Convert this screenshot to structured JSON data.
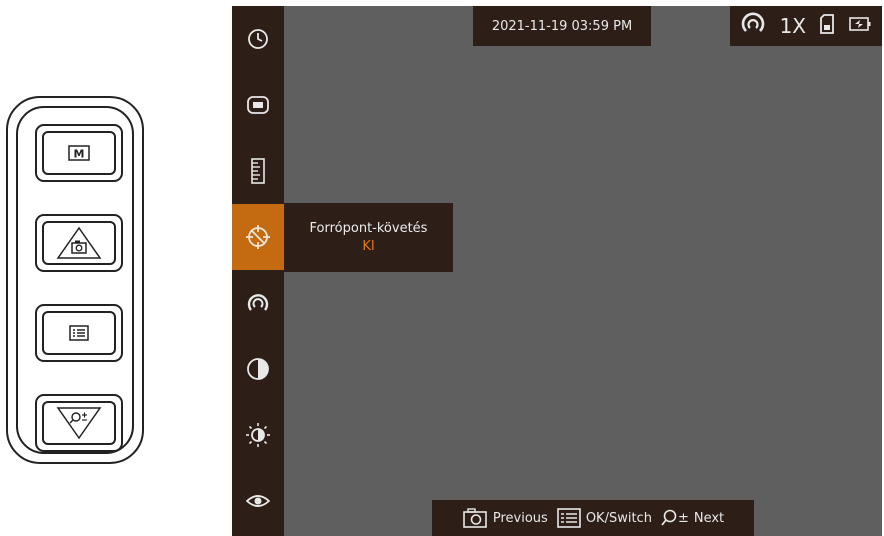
{
  "remote": {
    "buttons": [
      {
        "name": "m-button",
        "icon": "m-key-icon",
        "glyph": "M"
      },
      {
        "name": "capture-button",
        "icon": "camera-triangle-icon"
      },
      {
        "name": "menu-button",
        "icon": "menu-list-icon"
      },
      {
        "name": "zoom-button",
        "icon": "zoom-triangle-icon"
      }
    ]
  },
  "screen": {
    "datetime": "2021-11-19 03:59 PM",
    "status": {
      "zoom": "1X",
      "icons": [
        "palette-icon",
        "sd-card-icon",
        "battery-charging-icon"
      ]
    },
    "sidebar": {
      "items": [
        {
          "icon": "clock-icon"
        },
        {
          "icon": "display-mode-icon"
        },
        {
          "icon": "ruler-icon"
        },
        {
          "icon": "hot-spot-tracking-icon",
          "active": true
        },
        {
          "icon": "palette-icon"
        },
        {
          "icon": "contrast-icon"
        },
        {
          "icon": "brightness-icon"
        },
        {
          "icon": "eye-icon"
        }
      ]
    },
    "popup": {
      "title": "Forrópont-követés",
      "value": "KI"
    },
    "hints": {
      "previous": "Previous",
      "ok_switch": "OK/Switch",
      "next": "Next",
      "next_prefix": "±"
    },
    "colors": {
      "panel": "#2d1f18",
      "accent": "#c46a10",
      "value_text": "#e07a12",
      "image": "#5f5f5f"
    }
  }
}
